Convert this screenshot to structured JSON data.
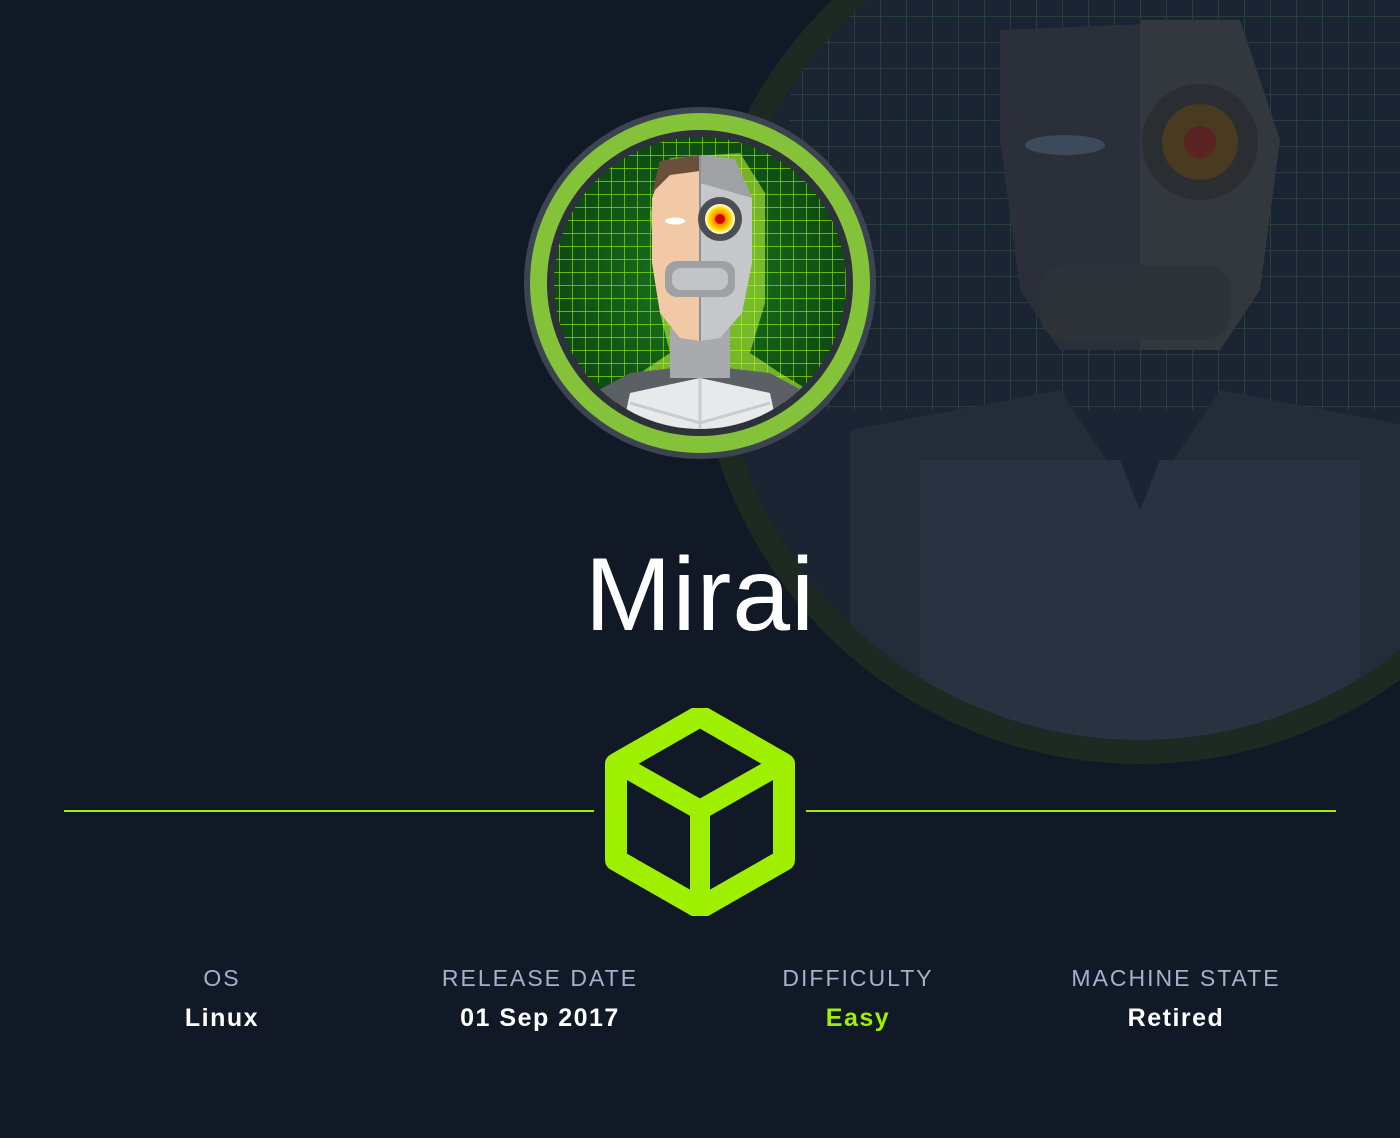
{
  "machine": {
    "name": "Mirai",
    "avatar_icon": "cyborg-avatar-icon",
    "logo_icon": "cube-icon"
  },
  "colors": {
    "background": "#111927",
    "accent": "#9fef00",
    "label": "#a4b1cd",
    "value": "#ffffff"
  },
  "stats": [
    {
      "label": "OS",
      "value": "Linux"
    },
    {
      "label": "RELEASE DATE",
      "value": "01 Sep 2017"
    },
    {
      "label": "DIFFICULTY",
      "value": "Easy"
    },
    {
      "label": "MACHINE STATE",
      "value": "Retired"
    }
  ]
}
